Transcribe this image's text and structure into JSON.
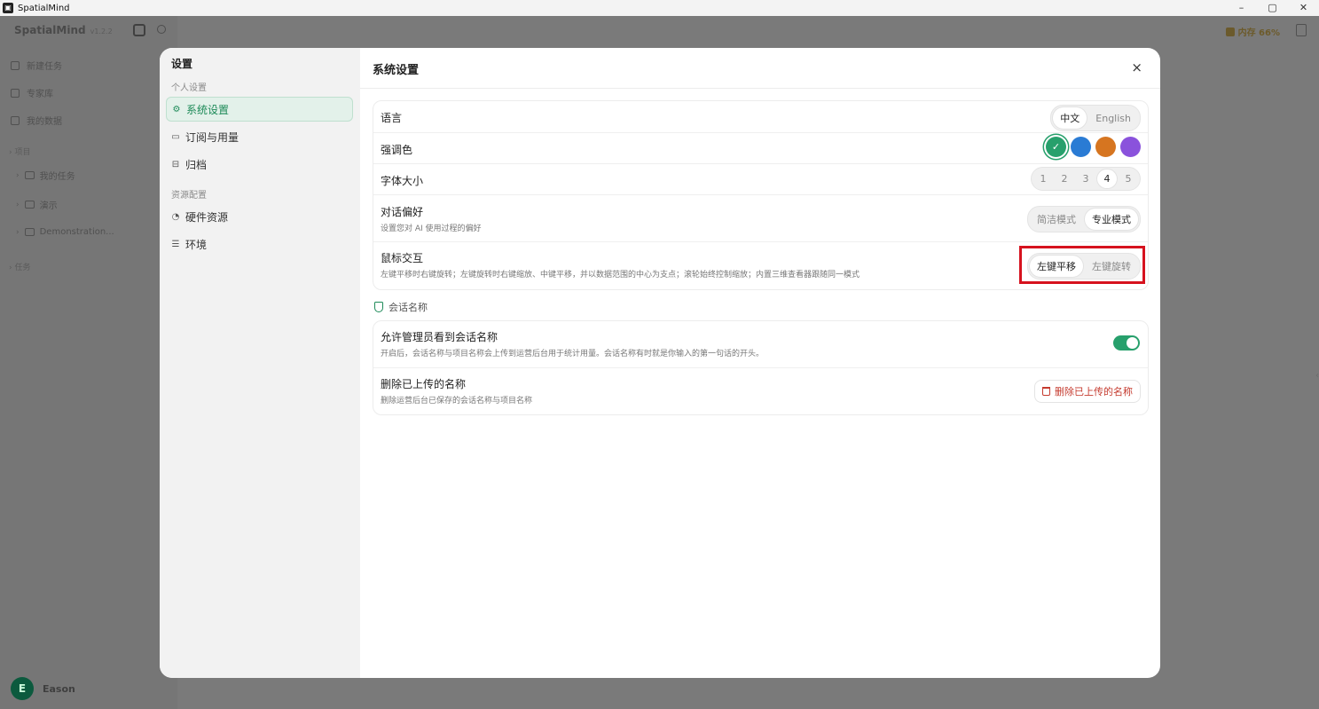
{
  "window": {
    "title": "SpatialMind",
    "controls": [
      "–",
      "▢",
      "✕"
    ]
  },
  "background": {
    "brand": "SpatialMind",
    "version": "v1.2.2",
    "nav": [
      "新建任务",
      "专家库",
      "我的数据"
    ],
    "section_projects": "项目",
    "folders": [
      "我的任务",
      "演示",
      "Demonstration..."
    ],
    "section_tasks": "任务",
    "user": {
      "initial": "E",
      "name": "Eason"
    },
    "status": "内存 66%"
  },
  "settings": {
    "sidebar": {
      "title": "设置",
      "group_personal": "个人设置",
      "items_personal": [
        {
          "icon": "⚙",
          "label": "系统设置"
        },
        {
          "icon": "▭",
          "label": "订阅与用量"
        },
        {
          "icon": "⊟",
          "label": "归档"
        }
      ],
      "group_resources": "资源配置",
      "items_resources": [
        {
          "icon": "◔",
          "label": "硬件资源"
        },
        {
          "icon": "☰",
          "label": "环境"
        }
      ]
    },
    "main": {
      "title": "系统设置",
      "close": "×",
      "language": {
        "label": "语言",
        "options": [
          "中文",
          "English"
        ],
        "selected": "中文"
      },
      "accent": {
        "label": "强调色",
        "check": "✓",
        "colors": [
          "#27a06c",
          "#2a7bd4",
          "#d67520",
          "#8a52dc"
        ],
        "selected": "#27a06c"
      },
      "font_size": {
        "label": "字体大小",
        "options": [
          "1",
          "2",
          "3",
          "4",
          "5"
        ],
        "selected": "4"
      },
      "chat_pref": {
        "label": "对话偏好",
        "desc": "设置您对 AI 使用过程的偏好",
        "options": [
          "简洁模式",
          "专业模式"
        ],
        "selected": "专业模式"
      },
      "mouse": {
        "label": "鼠标交互",
        "desc": "左键平移时右键旋转；左键旋转时右键缩放、中键平移，并以数据范围的中心为支点；滚轮始终控制缩放；内置三维查看器跟随同一模式",
        "options": [
          "左键平移",
          "左键旋转"
        ],
        "selected": "左键平移"
      },
      "session_section": "会话名称",
      "allow_admin": {
        "label": "允许管理员看到会话名称",
        "desc": "开启后，会话名称与项目名称会上传到运营后台用于统计用量。会话名称有时就是你输入的第一句话的开头。",
        "enabled": true
      },
      "delete_names": {
        "label": "删除已上传的名称",
        "desc": "删除运营后台已保存的会话名称与项目名称",
        "button": "删除已上传的名称"
      }
    }
  }
}
